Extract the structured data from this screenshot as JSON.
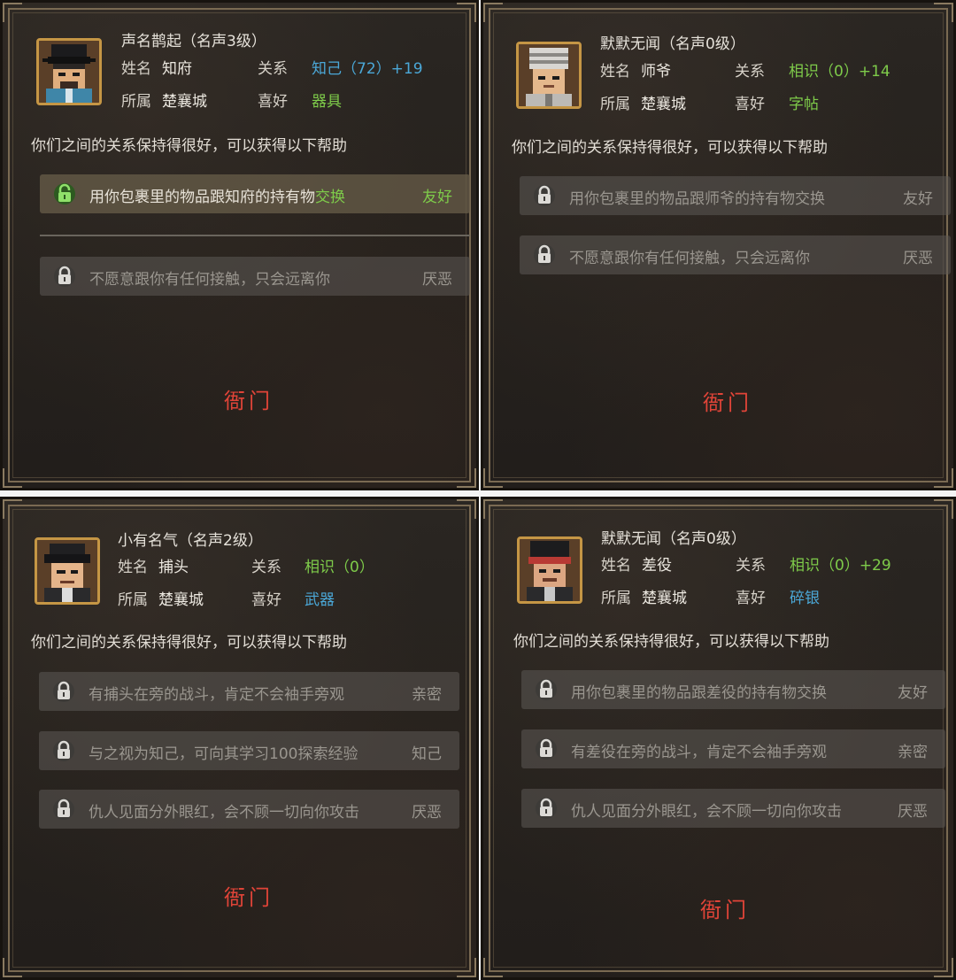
{
  "colors": {
    "green": "#7ecb4a",
    "blue": "#4ba8d8",
    "red": "#e04438",
    "gold": "#c59645"
  },
  "labels": {
    "name": "姓名",
    "relation": "关系",
    "faction": "所属",
    "hobby": "喜好"
  },
  "panels": [
    {
      "fame": "声名鹊起（名声3级）",
      "name": "知府",
      "relation": "知己（72）+19",
      "faction": "楚襄城",
      "hobby": "器具",
      "hobby_color": "green",
      "desc": "你们之间的关系保持得很好，可以获得以下帮助",
      "active_row": {
        "text_before": "用你包裹里的物品跟知府的持有物",
        "text_highlight": "交换",
        "tag": "友好",
        "icon": "unlocked-lock-icon"
      },
      "rows": [
        {
          "text": "不愿意跟你有任何接触，只会远离你",
          "tag": "厌恶",
          "icon": "lock-icon"
        }
      ],
      "place": "衙门",
      "avatar": "official-avatar"
    },
    {
      "fame": "默默无闻（名声0级）",
      "name": "师爷",
      "relation": "相识（0）+14",
      "faction": "楚襄城",
      "hobby": "字帖",
      "hobby_color": "green",
      "desc": "你们之间的关系保持得很好，可以获得以下帮助",
      "rows": [
        {
          "text": "用你包裹里的物品跟师爷的持有物交换",
          "tag": "友好",
          "icon": "lock-icon"
        },
        {
          "text": "不愿意跟你有任何接触，只会远离你",
          "tag": "厌恶",
          "icon": "lock-icon"
        }
      ],
      "place": "衙门",
      "avatar": "advisor-avatar"
    },
    {
      "fame": "小有名气（名声2级）",
      "name": "捕头",
      "relation": "相识（0）",
      "faction": "楚襄城",
      "hobby": "武器",
      "hobby_color": "blue",
      "desc": "你们之间的关系保持得很好，可以获得以下帮助",
      "rows": [
        {
          "text": "有捕头在旁的战斗，肯定不会袖手旁观",
          "tag": "亲密",
          "icon": "lock-icon"
        },
        {
          "text": "与之视为知己，可向其学习100探索经验",
          "tag": "知己",
          "icon": "lock-icon"
        },
        {
          "text": "仇人见面分外眼红，会不顾一切向你攻击",
          "tag": "厌恶",
          "icon": "lock-icon"
        }
      ],
      "place": "衙门",
      "avatar": "constable-avatar"
    },
    {
      "fame": "默默无闻（名声0级）",
      "name": "差役",
      "relation": "相识（0）+29",
      "faction": "楚襄城",
      "hobby": "碎银",
      "hobby_color": "blue",
      "desc": "你们之间的关系保持得很好，可以获得以下帮助",
      "rows": [
        {
          "text": "用你包裹里的物品跟差役的持有物交换",
          "tag": "友好",
          "icon": "lock-icon"
        },
        {
          "text": "有差役在旁的战斗，肯定不会袖手旁观",
          "tag": "亲密",
          "icon": "lock-icon"
        },
        {
          "text": "仇人见面分外眼红，会不顾一切向你攻击",
          "tag": "厌恶",
          "icon": "lock-icon"
        }
      ],
      "place": "衙门",
      "avatar": "runner-avatar"
    }
  ]
}
